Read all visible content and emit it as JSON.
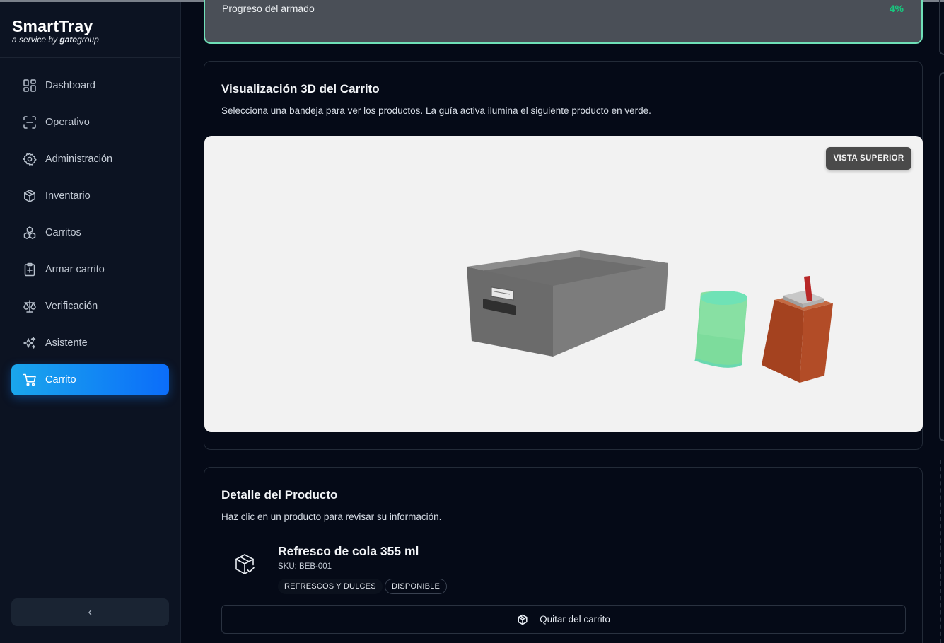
{
  "brand": {
    "name": "SmartTray",
    "tagline_prefix": "a service by",
    "tagline_gate": "gate",
    "tagline_group": "group"
  },
  "sidebar": {
    "items": [
      {
        "label": "Dashboard",
        "icon": "dashboard-icon"
      },
      {
        "label": "Operativo",
        "icon": "scan-icon"
      },
      {
        "label": "Administración",
        "icon": "gear-icon"
      },
      {
        "label": "Inventario",
        "icon": "box-icon"
      },
      {
        "label": "Carritos",
        "icon": "boxes-icon"
      },
      {
        "label": "Armar carrito",
        "icon": "clipboard-plus-icon"
      },
      {
        "label": "Verificación",
        "icon": "scale-icon"
      },
      {
        "label": "Asistente",
        "icon": "sparkles-icon"
      },
      {
        "label": "Carrito",
        "icon": "cart-icon",
        "active": true
      }
    ],
    "collapse_glyph": "‹"
  },
  "progress": {
    "label": "Progreso del armado",
    "value": "4%",
    "fraction": 0.04
  },
  "visualization": {
    "title": "Visualización 3D del Carrito",
    "description": "Selecciona una bandeja para ver los productos. La guía activa ilumina el siguiente producto en verde.",
    "view_button": "VISTA SUPERIOR",
    "highlight_color": "#6fe0b8"
  },
  "product": {
    "section_title": "Detalle del Producto",
    "section_desc": "Haz clic en un producto para revisar su información.",
    "name": "Refresco de cola 355 ml",
    "sku": "SKU: BEB-001",
    "category": "REFRESCOS Y DULCES",
    "status": "DISPONIBLE",
    "remove_label": "Quitar del carrito"
  },
  "colors": {
    "accent": "#0b6dfa",
    "success": "#17c97f"
  }
}
